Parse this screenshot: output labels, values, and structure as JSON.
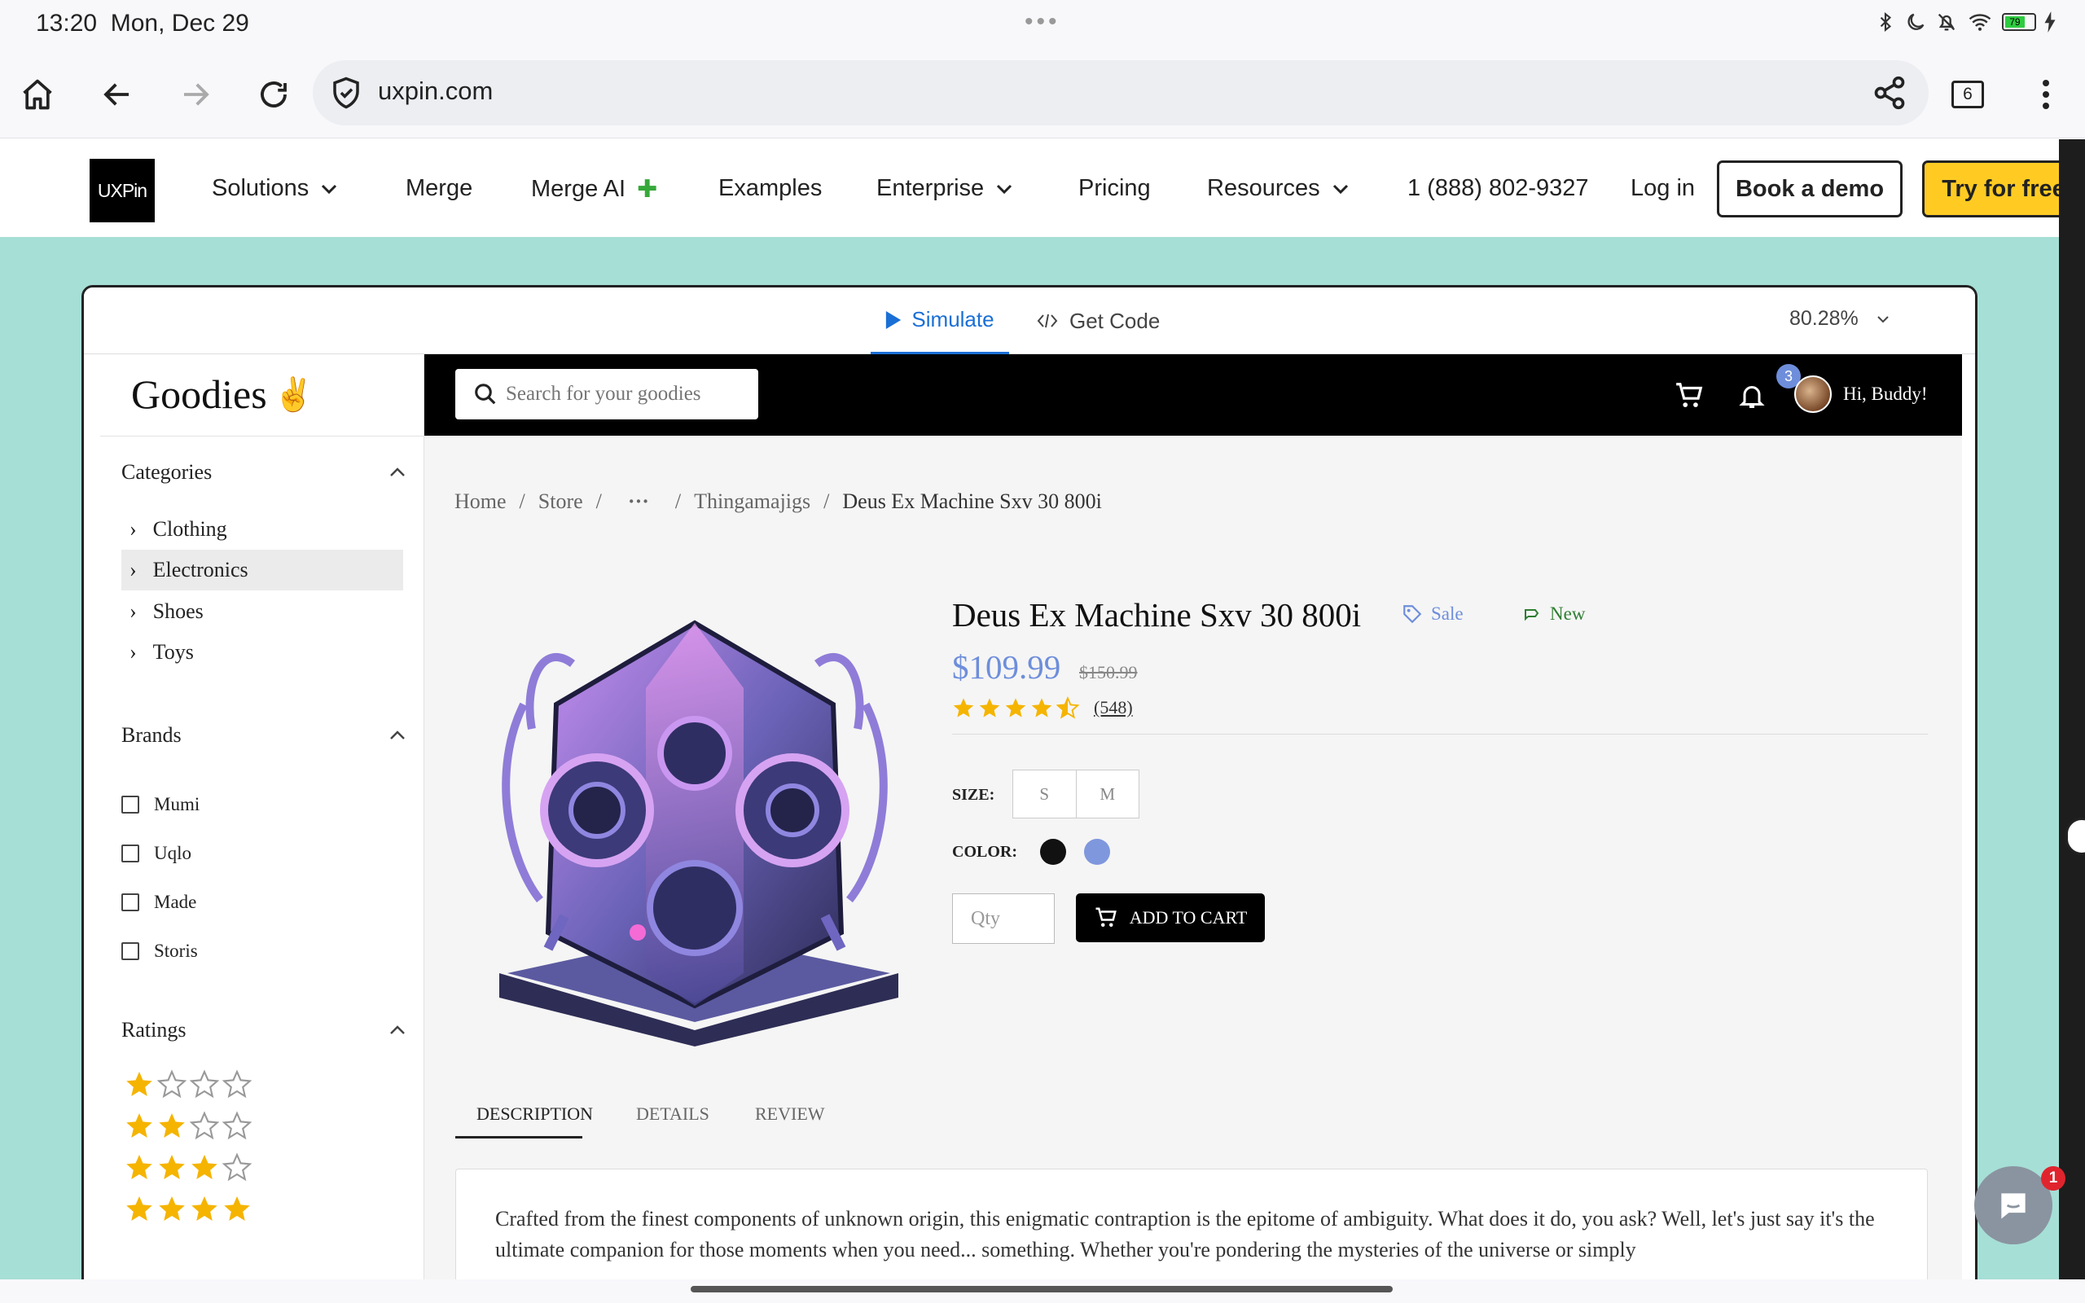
{
  "status_bar": {
    "time": "13:20",
    "date": "Mon, Dec 29",
    "battery": "79"
  },
  "browser": {
    "url": "uxpin.com",
    "tab_count": "6"
  },
  "site_nav": {
    "logo": "UXPin",
    "items": [
      "Solutions",
      "Merge",
      "Merge AI",
      "Examples",
      "Enterprise",
      "Pricing",
      "Resources"
    ],
    "phone": "1 (888) 802-9327",
    "login": "Log in",
    "book_demo": "Book a demo",
    "try_free": "Try for free"
  },
  "preview_toolbar": {
    "simulate": "Simulate",
    "get_code": "Get Code",
    "zoom": "80.28%"
  },
  "app": {
    "brand": "Goodies",
    "search_placeholder": "Search for your goodies",
    "notification_count": "3",
    "greeting": "Hi, Buddy!",
    "sidebar": {
      "categories_title": "Categories",
      "categories": [
        "Clothing",
        "Electronics",
        "Shoes",
        "Toys"
      ],
      "active_category": "Electronics",
      "brands_title": "Brands",
      "brands": [
        "Mumi",
        "Uqlo",
        "Made",
        "Storis"
      ],
      "ratings_title": "Ratings",
      "ratings": [
        1,
        2,
        3,
        4
      ]
    },
    "breadcrumb": {
      "home": "Home",
      "store": "Store",
      "ellipsis": "···",
      "parent": "Thingamajigs",
      "current": "Deus Ex Machine Sxv 30 800i"
    },
    "product": {
      "name": "Deus Ex Machine Sxv 30 800i",
      "sale_tag": "Sale",
      "new_tag": "New",
      "price": "$109.99",
      "old_price": "$150.99",
      "rating": 4.5,
      "review_count": "(548)",
      "size_label": "SIZE:",
      "sizes": [
        "S",
        "M"
      ],
      "color_label": "COLOR:",
      "colors": [
        "#111111",
        "#7f97dd"
      ],
      "qty_placeholder": "Qty",
      "add_to_cart": "ADD TO CART"
    },
    "tabs": [
      "DESCRIPTION",
      "DETAILS",
      "REVIEW"
    ],
    "active_tab": "DESCRIPTION",
    "description": "Crafted from the finest components of unknown origin, this enigmatic contraption is the epitome of ambiguity. What does it do, you ask? Well, let's just say it's the ultimate companion for those moments when you need... something. Whether you're pondering the mysteries of the universe or simply"
  },
  "chat_badge": "1",
  "colors": {
    "accent_blue": "#6e8edb",
    "simulate_blue": "#1a6fd6",
    "cta_yellow": "#ffcb23",
    "teal_bg": "#a6dfd6",
    "star": "#f5b400"
  }
}
